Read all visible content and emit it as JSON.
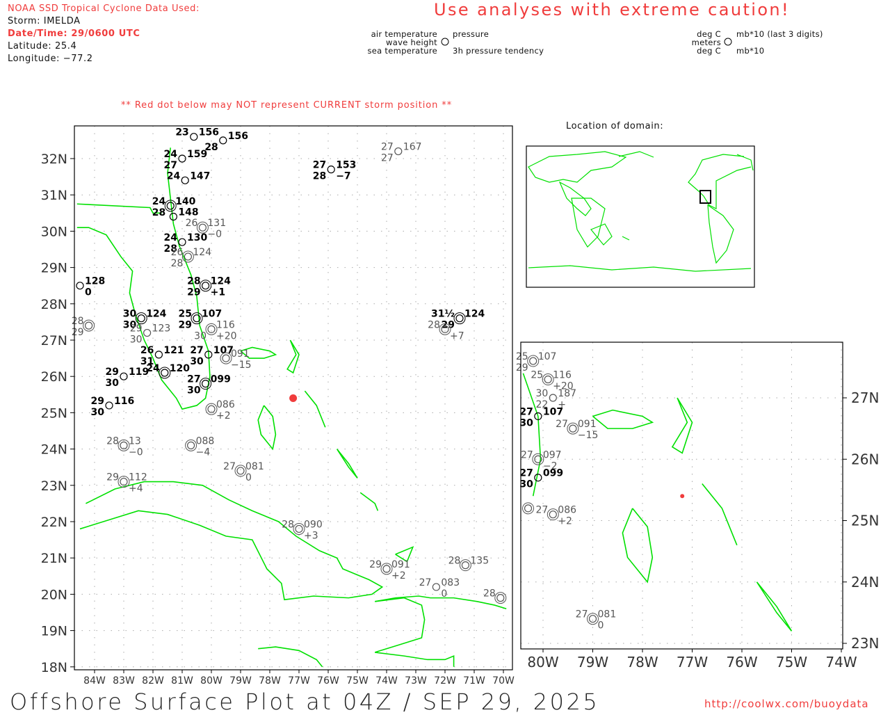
{
  "header": {
    "source": "NOAA SSD Tropical Cyclone Data Used:",
    "storm": "Storm: IMELDA",
    "datetime": "Date/Time: 29/0600 UTC",
    "latitude": "Latitude: 25.4",
    "longitude": "Longitude: −77.2",
    "caution": "Use analyses with extreme caution!",
    "red_dot_note": "** Red dot below may NOT represent CURRENT storm position **",
    "domain_label": "Location of domain:"
  },
  "legend": {
    "air_temperature": "air temperature",
    "wave_height": "wave height",
    "sea_temperature": "sea temperature",
    "pressure": "pressure",
    "tendency": "3h pressure tendency",
    "unit_air": "deg C",
    "unit_wave": "meters",
    "unit_sea": "deg C",
    "unit_pressure": "mb*10 (last 3 digits)",
    "unit_tendency": "mb*10"
  },
  "footer": {
    "title": "Offshore Surface Plot at 04Z / SEP 29, 2025",
    "url": "http://coolwx.com/buoydata"
  },
  "colors": {
    "coast": "#00e000",
    "red": "#f03c3c",
    "grid": "#aaaaaa",
    "dark": "#000000",
    "gray": "#555555"
  },
  "storm_position": {
    "lon_w": 77.2,
    "lat_n": 25.4
  },
  "main_map": {
    "lat_labels": [
      "32N",
      "31N",
      "30N",
      "29N",
      "28N",
      "27N",
      "26N",
      "25N",
      "24N",
      "23N",
      "22N",
      "21N",
      "20N",
      "19N",
      "18N"
    ],
    "lon_labels": [
      "84W",
      "83W",
      "82W",
      "81W",
      "80W",
      "79W",
      "78W",
      "77W",
      "76W",
      "75W",
      "74W",
      "73W",
      "72W",
      "71W",
      "70W"
    ]
  },
  "inset_map": {
    "lat_labels": [
      "27N",
      "26N",
      "25N",
      "24N",
      "23N"
    ],
    "lon_labels": [
      "80W",
      "79W",
      "78W",
      "77W",
      "76W",
      "75W",
      "74W"
    ]
  },
  "stations_main": [
    {
      "lon": 75.9,
      "lat": 31.7,
      "t": "27",
      "p": "153",
      "s": "28",
      "d": "−7",
      "dark": true,
      "ring": false
    },
    {
      "lon": 73.6,
      "lat": 32.2,
      "t": "27",
      "p": "167",
      "s": "27",
      "d": "",
      "dark": false,
      "ring": false
    },
    {
      "lon": 71.5,
      "lat": 27.6,
      "t": "31½",
      "p": "124",
      "s": "29",
      "d": "",
      "dark": true,
      "ring": true
    },
    {
      "lon": 72.0,
      "lat": 27.3,
      "t": "28",
      "p": "",
      "s": "",
      "d": "+7",
      "dark": false,
      "ring": true
    },
    {
      "lon": 77.0,
      "lat": 21.8,
      "t": "28",
      "p": "090",
      "s": "",
      "d": "+3",
      "dark": false,
      "ring": true
    },
    {
      "lon": 74.0,
      "lat": 20.7,
      "t": "29",
      "p": "091",
      "s": "",
      "d": "+2",
      "dark": false,
      "ring": true
    },
    {
      "lon": 71.3,
      "lat": 20.8,
      "t": "28",
      "p": "135",
      "s": "",
      "d": "",
      "dark": false,
      "ring": true
    },
    {
      "lon": 72.3,
      "lat": 20.2,
      "t": "27",
      "p": "083",
      "s": "",
      "d": "0",
      "dark": false,
      "ring": false
    },
    {
      "lon": 70.1,
      "lat": 19.9,
      "t": "28",
      "p": "",
      "s": "",
      "d": "",
      "dark": false,
      "ring": true
    },
    {
      "lon": 79.0,
      "lat": 23.4,
      "t": "27",
      "p": "081",
      "s": "",
      "d": "0",
      "dark": false,
      "ring": true
    },
    {
      "lon": 83.0,
      "lat": 23.1,
      "t": "29",
      "p": "112",
      "s": "",
      "d": "+4",
      "dark": false,
      "ring": true
    },
    {
      "lon": 83.0,
      "lat": 24.1,
      "t": "28",
      "p": "13",
      "s": "",
      "d": "−0",
      "dark": false,
      "ring": true
    },
    {
      "lon": 80.7,
      "lat": 24.1,
      "t": "",
      "p": "088",
      "s": "",
      "d": "−4",
      "dark": false,
      "ring": true
    },
    {
      "lon": 80.0,
      "lat": 25.1,
      "t": "",
      "p": "086",
      "s": "",
      "d": "+2",
      "dark": false,
      "ring": true
    },
    {
      "lon": 83.5,
      "lat": 25.2,
      "t": "29",
      "p": "116",
      "s": "30",
      "d": "",
      "dark": true,
      "ring": false
    },
    {
      "lon": 83.0,
      "lat": 26.0,
      "t": "29",
      "p": "119",
      "s": "30",
      "d": "",
      "dark": true,
      "ring": false
    },
    {
      "lon": 81.6,
      "lat": 26.1,
      "t": "24",
      "p": "120",
      "s": "",
      "d": "",
      "dark": true,
      "ring": true
    },
    {
      "lon": 81.8,
      "lat": 26.6,
      "t": "26",
      "p": "121",
      "s": "31",
      "d": "",
      "dark": true,
      "ring": false
    },
    {
      "lon": 80.5,
      "lat": 27.6,
      "t": "25",
      "p": "107",
      "s": "29",
      "d": "",
      "dark": true,
      "ring": true
    },
    {
      "lon": 80.0,
      "lat": 27.3,
      "t": "",
      "p": "116",
      "s": "30",
      "d": "+20",
      "dark": false,
      "ring": true
    },
    {
      "lon": 80.1,
      "lat": 26.6,
      "t": "27",
      "p": "107",
      "s": "30",
      "d": "",
      "dark": true,
      "ring": false
    },
    {
      "lon": 79.5,
      "lat": 26.5,
      "t": "",
      "p": "091",
      "s": "",
      "d": "−15",
      "dark": false,
      "ring": true
    },
    {
      "lon": 80.2,
      "lat": 25.8,
      "t": "27",
      "p": "099",
      "s": "30",
      "d": "",
      "dark": true,
      "ring": true
    },
    {
      "lon": 84.5,
      "lat": 28.5,
      "t": "",
      "p": "128",
      "s": "",
      "d": "0",
      "dark": true,
      "ring": false
    },
    {
      "lon": 84.2,
      "lat": 27.4,
      "t": "28",
      "p": "",
      "s": "29",
      "d": "",
      "dark": false,
      "ring": true
    },
    {
      "lon": 82.4,
      "lat": 27.6,
      "t": "30",
      "p": "124",
      "s": "30",
      "d": "",
      "dark": true,
      "ring": true
    },
    {
      "lon": 82.2,
      "lat": 27.2,
      "t": "29",
      "p": "123",
      "s": "30",
      "d": "",
      "dark": false,
      "ring": false
    },
    {
      "lon": 81.0,
      "lat": 29.7,
      "t": "24",
      "p": "130",
      "s": "28",
      "d": "",
      "dark": true,
      "ring": false
    },
    {
      "lon": 80.3,
      "lat": 30.1,
      "t": "26",
      "p": "131",
      "s": "",
      "d": "−0",
      "dark": false,
      "ring": true
    },
    {
      "lon": 80.8,
      "lat": 29.3,
      "t": "26",
      "p": "124",
      "s": "28",
      "d": "",
      "dark": false,
      "ring": true
    },
    {
      "lon": 81.4,
      "lat": 30.7,
      "t": "24",
      "p": "140",
      "s": "28",
      "d": "",
      "dark": true,
      "ring": true
    },
    {
      "lon": 81.3,
      "lat": 30.4,
      "t": "",
      "p": "148",
      "s": "",
      "d": "",
      "dark": true,
      "ring": false
    },
    {
      "lon": 81.0,
      "lat": 32.0,
      "t": "24",
      "p": "159",
      "s": "27",
      "d": "",
      "dark": true,
      "ring": false
    },
    {
      "lon": 80.9,
      "lat": 31.4,
      "t": "24",
      "p": "147",
      "s": "",
      "d": "",
      "dark": true,
      "ring": false
    },
    {
      "lon": 80.6,
      "lat": 32.6,
      "t": "23",
      "p": "156",
      "s": "",
      "d": "",
      "dark": true,
      "ring": false
    },
    {
      "lon": 79.6,
      "lat": 32.5,
      "t": "",
      "p": "156",
      "s": "28",
      "d": "",
      "dark": true,
      "ring": false
    },
    {
      "lon": 80.2,
      "lat": 28.5,
      "t": "28",
      "p": "124",
      "s": "29",
      "d": "+1",
      "dark": true,
      "ring": true
    }
  ],
  "stations_inset": [
    {
      "lon": 80.2,
      "lat": 27.6,
      "t": "25",
      "p": "107",
      "s": "29",
      "d": "",
      "dark": false,
      "ring": true
    },
    {
      "lon": 79.9,
      "lat": 27.3,
      "t": "25",
      "p": "116",
      "s": "",
      "d": "+20",
      "dark": false,
      "ring": true
    },
    {
      "lon": 79.8,
      "lat": 27.0,
      "t": "30",
      "p": "187",
      "s": "22",
      "d": "+",
      "dark": false,
      "ring": false
    },
    {
      "lon": 80.1,
      "lat": 26.7,
      "t": "27",
      "p": "107",
      "s": "30",
      "d": "",
      "dark": true,
      "ring": false
    },
    {
      "lon": 79.4,
      "lat": 26.5,
      "t": "27",
      "p": "091",
      "s": "",
      "d": "−15",
      "dark": false,
      "ring": true
    },
    {
      "lon": 80.1,
      "lat": 26.0,
      "t": "27",
      "p": "097",
      "s": "",
      "d": "−2",
      "dark": false,
      "ring": true
    },
    {
      "lon": 80.1,
      "lat": 25.7,
      "t": "27",
      "p": "099",
      "s": "30",
      "d": "",
      "dark": true,
      "ring": false
    },
    {
      "lon": 80.3,
      "lat": 25.2,
      "t": "",
      "p": "",
      "s": "",
      "d": "",
      "dark": false,
      "ring": true
    },
    {
      "lon": 79.8,
      "lat": 25.1,
      "t": "27",
      "p": "086",
      "s": "",
      "d": "+2",
      "dark": false,
      "ring": true
    },
    {
      "lon": 79.0,
      "lat": 23.4,
      "t": "27",
      "p": "081",
      "s": "",
      "d": "0",
      "dark": false,
      "ring": true
    }
  ]
}
